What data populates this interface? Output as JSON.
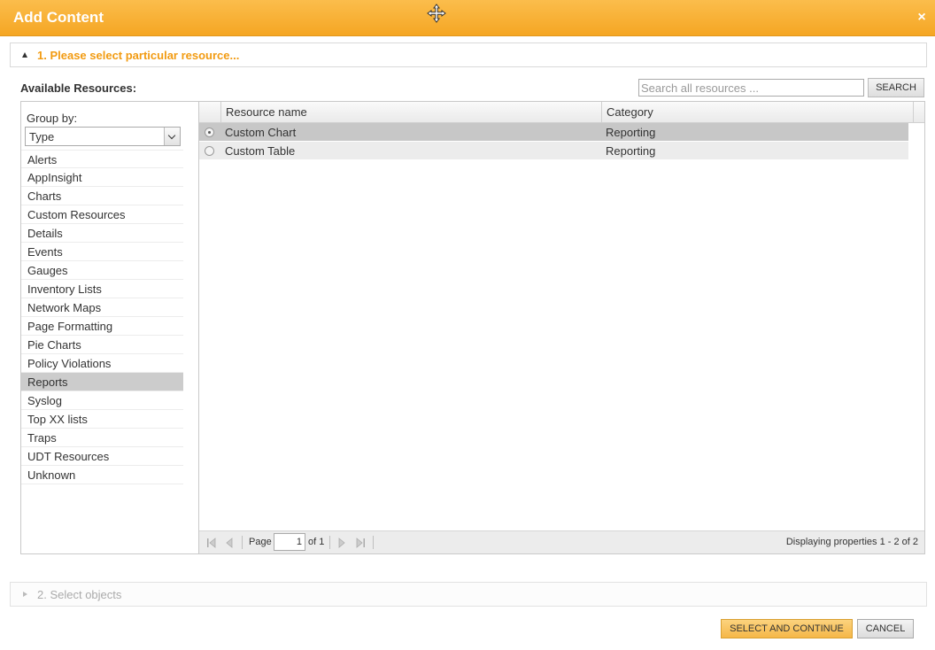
{
  "dialog": {
    "title": "Add Content",
    "close_glyph": "×",
    "accent_color": "#f5a623"
  },
  "step1": {
    "label": "1. Please select particular resource..."
  },
  "available": {
    "label": "Available Resources:"
  },
  "search": {
    "placeholder": "Search all resources ...",
    "button_label": "SEARCH"
  },
  "group_by": {
    "label": "Group by:",
    "selected": "Type",
    "items": [
      "Alerts",
      "AppInsight",
      "Charts",
      "Custom Resources",
      "Details",
      "Events",
      "Gauges",
      "Inventory Lists",
      "Network Maps",
      "Page Formatting",
      "Pie Charts",
      "Policy Violations",
      "Reports",
      "Syslog",
      "Top XX lists",
      "Traps",
      "UDT Resources",
      "Unknown"
    ],
    "selected_item": "Reports"
  },
  "grid": {
    "columns": [
      "Resource name",
      "Category"
    ],
    "rows": [
      {
        "name": "Custom Chart",
        "category": "Reporting",
        "selected": true
      },
      {
        "name": "Custom Table",
        "category": "Reporting",
        "selected": false
      }
    ]
  },
  "pager": {
    "page_label": "Page",
    "page_value": "1",
    "of_label": "of 1",
    "display_text": "Displaying properties 1 - 2 of 2"
  },
  "step2": {
    "label": "2. Select objects"
  },
  "footer": {
    "primary_label": "SELECT AND CONTINUE",
    "cancel_label": "CANCEL"
  }
}
